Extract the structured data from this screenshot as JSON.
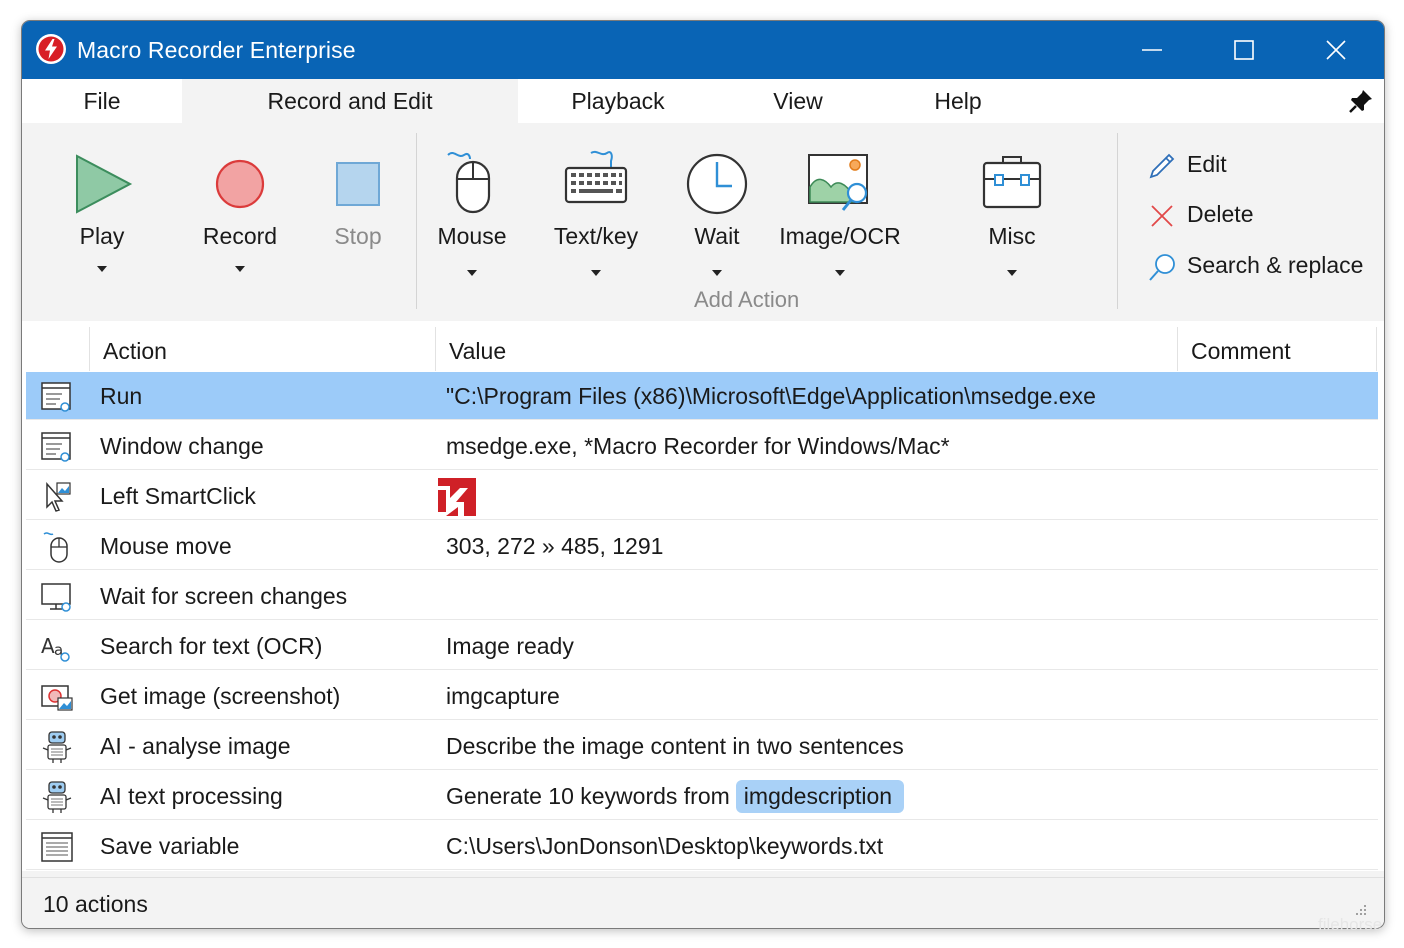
{
  "window": {
    "title": "Macro Recorder Enterprise",
    "accent_color": "#0964b5",
    "controls": [
      "minimize-icon",
      "maximize-icon",
      "close-icon"
    ]
  },
  "menu": {
    "items": [
      {
        "label": "File",
        "active": false
      },
      {
        "label": "Record and Edit",
        "active": true
      },
      {
        "label": "Playback",
        "active": false
      },
      {
        "label": "View",
        "active": false
      },
      {
        "label": "Help",
        "active": false
      }
    ],
    "pin_icon": "pin-icon"
  },
  "ribbon": {
    "buttons": [
      {
        "label": "Play",
        "icon": "play-icon",
        "dropdown": true,
        "enabled": true
      },
      {
        "label": "Record",
        "icon": "record-icon",
        "dropdown": true,
        "enabled": true
      },
      {
        "label": "Stop",
        "icon": "stop-icon",
        "dropdown": false,
        "enabled": false
      },
      {
        "label": "Mouse",
        "icon": "mouse-icon",
        "dropdown": true,
        "enabled": true
      },
      {
        "label": "Text/key",
        "icon": "keyboard-icon",
        "dropdown": true,
        "enabled": true
      },
      {
        "label": "Wait",
        "icon": "clock-icon",
        "dropdown": true,
        "enabled": true
      },
      {
        "label": "Image/OCR",
        "icon": "image-search-icon",
        "dropdown": true,
        "enabled": true
      },
      {
        "label": "Misc",
        "icon": "toolbox-icon",
        "dropdown": true,
        "enabled": true
      }
    ],
    "group_label": "Add Action",
    "side_actions": [
      {
        "label": "Edit",
        "icon": "pencil-icon"
      },
      {
        "label": "Delete",
        "icon": "delete-x-icon"
      },
      {
        "label": "Search & replace",
        "icon": "magnifier-icon"
      }
    ]
  },
  "table": {
    "columns": [
      "Action",
      "Value",
      "Comment"
    ],
    "rows": [
      {
        "icon": "run-window-icon",
        "action": "Run",
        "value": "\"C:\\Program Files (x86)\\Microsoft\\Edge\\Application\\msedge.exe",
        "selected": true
      },
      {
        "icon": "window-change-icon",
        "action": "Window change",
        "value": "msedge.exe, *Macro Recorder for Windows/Mac*",
        "selected": false
      },
      {
        "icon": "smartclick-cursor-icon",
        "action": "Left SmartClick",
        "value": "",
        "value_image": "smartclick-thumbnail-icon",
        "selected": false
      },
      {
        "icon": "mouse-move-icon",
        "action": "Mouse move",
        "value": "303, 272 » 485, 1291",
        "selected": false
      },
      {
        "icon": "screen-change-icon",
        "action": "Wait for screen changes",
        "value": "",
        "selected": false
      },
      {
        "icon": "ocr-text-icon",
        "action": "Search for text (OCR)",
        "value": "Image ready",
        "selected": false
      },
      {
        "icon": "screenshot-icon",
        "action": "Get image (screenshot)",
        "value": "imgcapture",
        "selected": false
      },
      {
        "icon": "robot-icon",
        "action": "AI - analyse image",
        "value": "Describe the image content in two sentences",
        "selected": false
      },
      {
        "icon": "robot-icon",
        "action": "AI text processing",
        "value": "Generate 10 keywords from",
        "variable": "imgdescription",
        "selected": false
      },
      {
        "icon": "save-variable-icon",
        "action": "Save variable",
        "value": "C:\\Users\\JonDonson\\Desktop\\keywords.txt",
        "selected": false
      }
    ]
  },
  "status": {
    "text": "10 actions"
  },
  "watermark": "filehorse"
}
